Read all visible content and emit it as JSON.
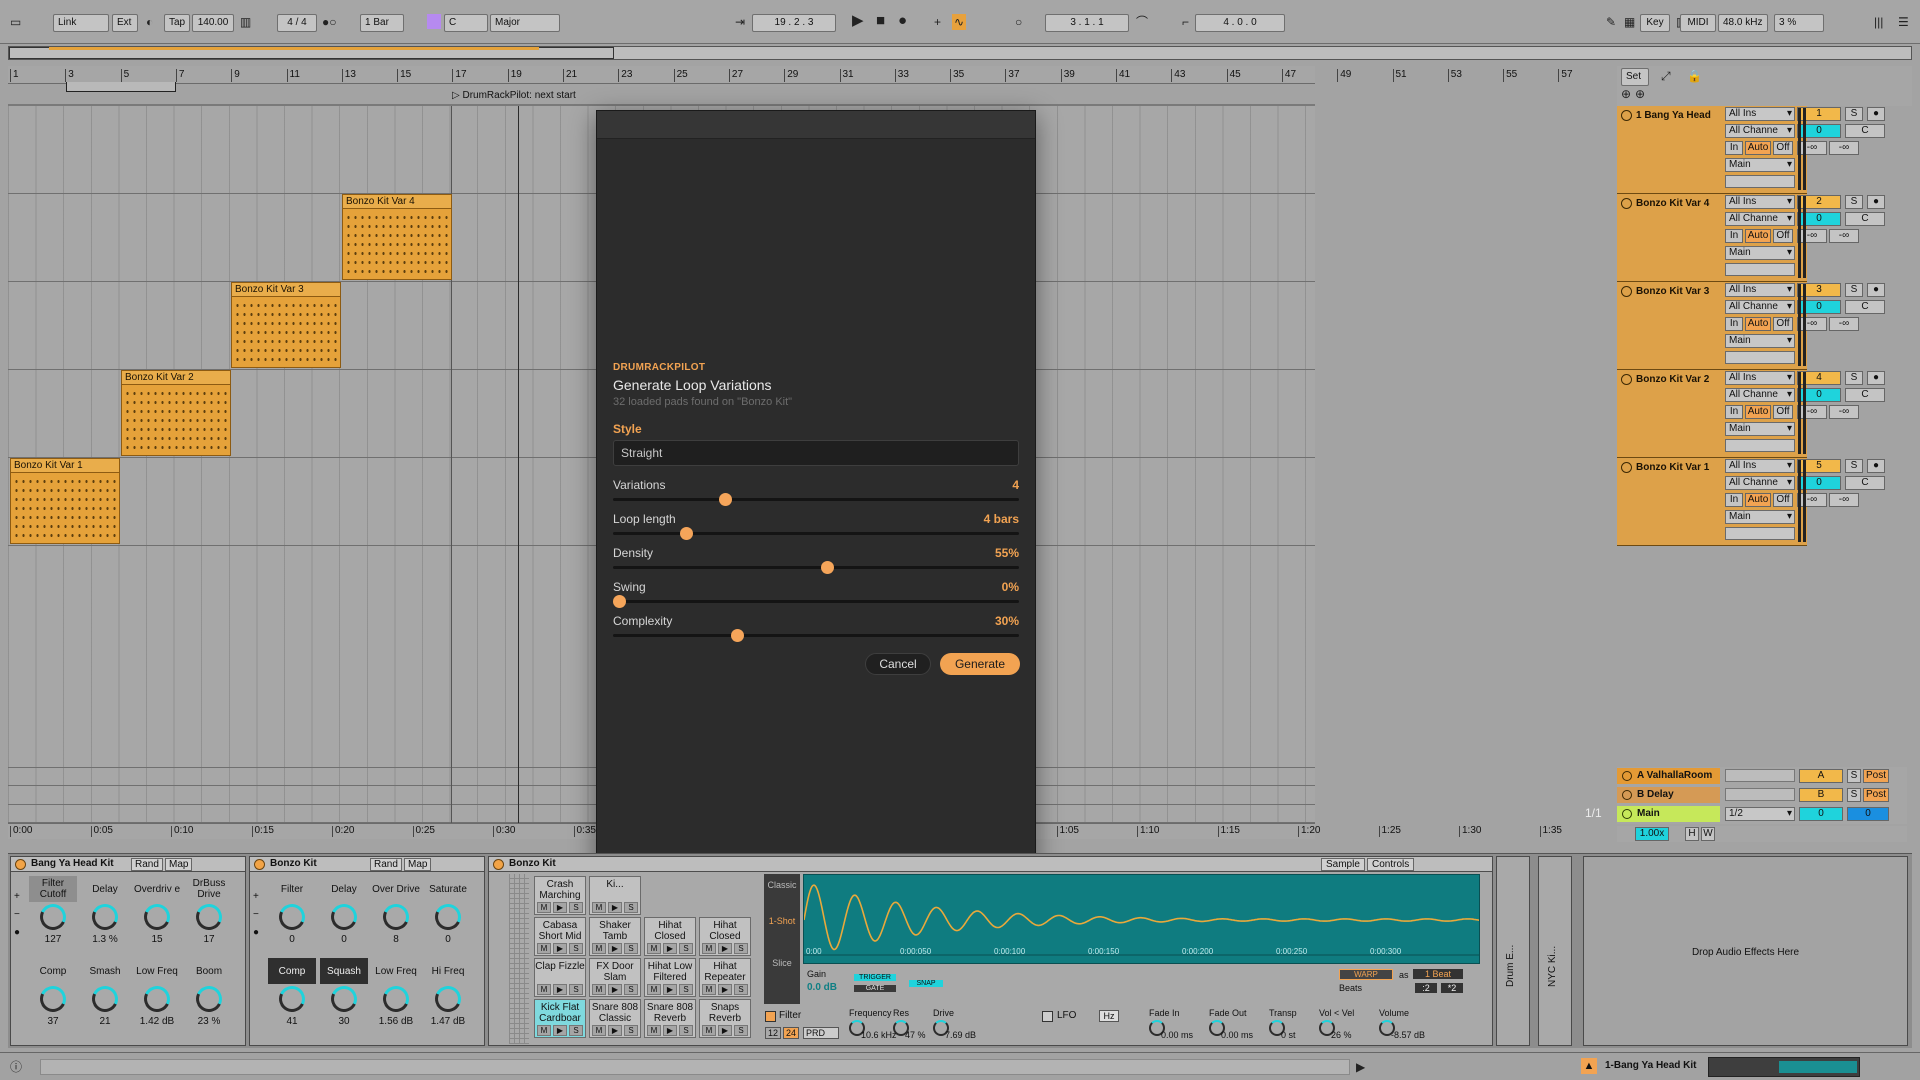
{
  "transport": {
    "link": "Link",
    "ext": "Ext",
    "tap": "Tap",
    "tempo": "140.00",
    "signature": "4 / 4",
    "quantize": "1 Bar",
    "key": "C",
    "scale": "Major",
    "position": "19 .  2 .  3",
    "loop_start": "3 .  1 .  1",
    "loop_length": "4 .  0 .  0",
    "key_btn": "Key",
    "midi_btn": "MIDI",
    "sample_rate": "48.0 kHz",
    "cpu": "3 %"
  },
  "ruler": {
    "bars": [
      "1",
      "3",
      "5",
      "7",
      "9",
      "11",
      "13",
      "15",
      "17",
      "19",
      "21",
      "23",
      "25",
      "27",
      "29",
      "31",
      "33",
      "35",
      "37",
      "39",
      "41",
      "43",
      "45",
      "47",
      "49",
      "51",
      "53",
      "55",
      "57"
    ],
    "marker": "DrumRackPilot: next start",
    "times": [
      "0:00",
      "0:05",
      "0:10",
      "0:15",
      "0:20",
      "0:25",
      "0:30",
      "0:35",
      "0:40",
      "0:45",
      "0:50",
      "0:55",
      "1:00",
      "1:05",
      "1:10",
      "1:15",
      "1:20",
      "1:25",
      "1:30",
      "1:35"
    ],
    "zoom_page": "1/1"
  },
  "clips": [
    {
      "name": "Bonzo Kit Var 4"
    },
    {
      "name": "Bonzo Kit Var 3"
    },
    {
      "name": "Bonzo Kit Var 2"
    },
    {
      "name": "Bonzo Kit Var 1"
    }
  ],
  "mixer": {
    "set_label": "Set",
    "tracks": [
      {
        "name": "1 Bang Ya Head",
        "input": "All Ins",
        "channel": "All Channe",
        "num": "1",
        "s": "S",
        "vol": "0",
        "pan": "C",
        "in": "In",
        "auto": "Auto",
        "off": "Off",
        "a": "-∞",
        "b": "-∞",
        "out": "Main"
      },
      {
        "name": "Bonzo Kit Var 4",
        "input": "All Ins",
        "channel": "All Channe",
        "num": "2",
        "s": "S",
        "vol": "0",
        "pan": "C",
        "in": "In",
        "auto": "Auto",
        "off": "Off",
        "a": "-∞",
        "b": "-∞",
        "out": "Main"
      },
      {
        "name": "Bonzo Kit Var 3",
        "input": "All Ins",
        "channel": "All Channe",
        "num": "3",
        "s": "S",
        "vol": "0",
        "pan": "C",
        "in": "In",
        "auto": "Auto",
        "off": "Off",
        "a": "-∞",
        "b": "-∞",
        "out": "Main"
      },
      {
        "name": "Bonzo Kit Var 2",
        "input": "All Ins",
        "channel": "All Channe",
        "num": "4",
        "s": "S",
        "vol": "0",
        "pan": "C",
        "in": "In",
        "auto": "Auto",
        "off": "Off",
        "a": "-∞",
        "b": "-∞",
        "out": "Main"
      },
      {
        "name": "Bonzo Kit Var 1",
        "input": "All Ins",
        "channel": "All Channe",
        "num": "5",
        "s": "S",
        "vol": "0",
        "pan": "C",
        "in": "In",
        "auto": "Auto",
        "off": "Off",
        "a": "-∞",
        "b": "-∞",
        "out": "Main"
      }
    ],
    "returns": [
      {
        "name": "A ValhallaRoom",
        "letter": "A",
        "s": "S",
        "post": "Post"
      },
      {
        "name": "B Delay",
        "letter": "B",
        "s": "S",
        "post": "Post"
      }
    ],
    "main": {
      "name": "Main",
      "io": "1/2",
      "vol": "0",
      "vol2": "0"
    },
    "zoom": "1.00x",
    "h": "H",
    "w": "W"
  },
  "modal": {
    "brand": "DRUMRACKPILOT",
    "title": "Generate Loop Variations",
    "subtitle": "32 loaded pads found on \"Bonzo Kit\"",
    "style_label": "Style",
    "style_value": "Straight",
    "sliders": [
      {
        "label": "Variations",
        "value": "4",
        "fraction": 0.27
      },
      {
        "label": "Loop length",
        "value": "4 bars",
        "fraction": 0.17
      },
      {
        "label": "Density",
        "value": "55%",
        "fraction": 0.53
      },
      {
        "label": "Swing",
        "value": "0%",
        "fraction": 0.0
      },
      {
        "label": "Complexity",
        "value": "30%",
        "fraction": 0.3
      }
    ],
    "cancel": "Cancel",
    "generate": "Generate"
  },
  "devices": {
    "rack1": {
      "title": "Bang Ya Head Kit",
      "rand": "Rand",
      "map": "Map",
      "macros": [
        {
          "label": "Filter Cutoff",
          "value": "127"
        },
        {
          "label": "Delay",
          "value": "1.3 %"
        },
        {
          "label": "Overdriv e",
          "value": "15"
        },
        {
          "label": "DrBuss Drive",
          "value": "17"
        },
        {
          "label": "Comp",
          "value": "37"
        },
        {
          "label": "Smash",
          "value": "21"
        },
        {
          "label": "Low Freq",
          "value": "1.42 dB"
        },
        {
          "label": "Boom",
          "value": "23 %"
        }
      ]
    },
    "rack2": {
      "title": "Bonzo Kit",
      "rand": "Rand",
      "map": "Map",
      "macros": [
        {
          "label": "Filter",
          "value": "0"
        },
        {
          "label": "Delay",
          "value": "0"
        },
        {
          "label": "Over Drive",
          "value": "8"
        },
        {
          "label": "Saturate",
          "value": "0"
        },
        {
          "label": "Comp",
          "value": "41"
        },
        {
          "label": "Squash",
          "value": "30"
        },
        {
          "label": "Low Freq",
          "value": "1.56 dB"
        },
        {
          "label": "Hi Freq",
          "value": "1.47 dB"
        }
      ]
    },
    "drumrack": {
      "title": "Bonzo Kit",
      "pads": [
        "Crash Marching",
        "Ki...",
        "Cabasa Short Mid",
        "Shaker Tamb",
        "Hihat Closed",
        "Hihat Closed",
        "Clap Fizzle",
        "FX Door Slam",
        "Hihat Low Filtered",
        "Hihat Repeater",
        "Kick Flat Cardboar",
        "Snare 808 Classic",
        "Snare 808 Reverb",
        "Snaps Reverb"
      ],
      "m": "M",
      "s": "S"
    },
    "sampler": {
      "tabs": [
        "Sample",
        "Controls"
      ],
      "classic": "Classic",
      "oneshot": "1-Shot",
      "slice": "Slice",
      "gain_label": "Gain",
      "gain": "0.0 dB",
      "trigger": "TRIGGER",
      "gate": "GATE",
      "snap": "SNAP",
      "warp": "WARP",
      "as": "as",
      "beat": "1 Beat",
      "beats": "Beats",
      "div2": ":2",
      "mul2": "*2",
      "times": [
        "0:00",
        "0:00:050",
        "0:00:100",
        "0:00:150",
        "0:00:200",
        "0:00:250",
        "0:00:300"
      ],
      "filter": "Filter",
      "f12": "12",
      "f24": "24",
      "prd": "PRD",
      "freq_label": "Frequency",
      "freq": "10.6 kHz",
      "res_label": "Res",
      "res": "47 %",
      "drive_label": "Drive",
      "drive": "7.69 dB",
      "lfo": "LFO",
      "hz": "Hz",
      "fadein_label": "Fade In",
      "fadein": "0.00 ms",
      "fadeout_label": "Fade Out",
      "fadeout": "0.00 ms",
      "transp_label": "Transp",
      "transp": "0 st",
      "velvol_label": "Vol < Vel",
      "velvol": "26 %",
      "volume_label": "Volume",
      "volume": "-8.57 dB"
    },
    "chain1": "Drum E...",
    "chain2": "NYC Ki...",
    "drop": "Drop Audio Effects Here"
  },
  "status": {
    "track": "1-Bang Ya Head Kit"
  },
  "colors": {
    "accent": "#f2a352",
    "clip": "#e5a23a",
    "cyan": "#1fd3dc",
    "modal_bg": "#2c2c2c"
  }
}
